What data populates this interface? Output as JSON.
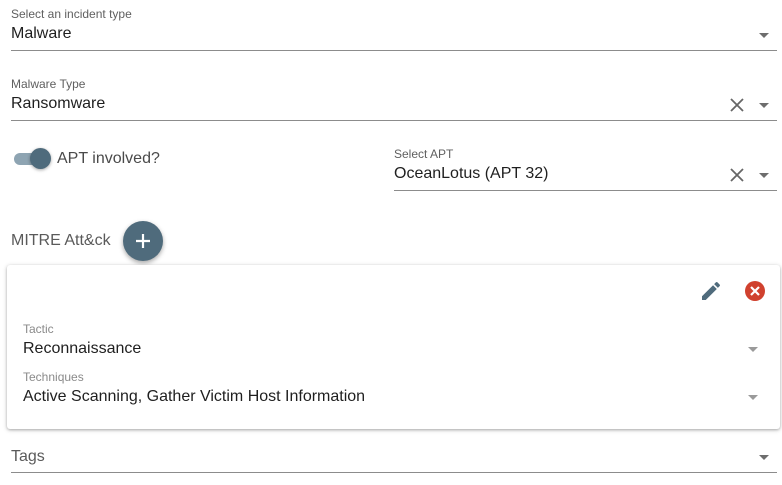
{
  "incident_type": {
    "label": "Select an incident type",
    "value": "Malware"
  },
  "malware_type": {
    "label": "Malware Type",
    "value": "Ransomware"
  },
  "apt_toggle": {
    "label": "APT involved?",
    "checked": true
  },
  "select_apt": {
    "label": "Select APT",
    "value": "OceanLotus (APT 32)"
  },
  "mitre": {
    "title": "MITRE Att&ck",
    "add_icon": "plus-icon",
    "card": {
      "edit_icon": "pencil-icon",
      "delete_icon": "close-circle-icon",
      "tactic": {
        "label": "Tactic",
        "value": "Reconnaissance"
      },
      "techniques": {
        "label": "Techniques",
        "value": "Active Scanning,  Gather Victim Host Information"
      }
    }
  },
  "tags": {
    "placeholder": "Tags"
  },
  "colors": {
    "accent": "#4f6b7c",
    "danger": "#d0412e"
  }
}
